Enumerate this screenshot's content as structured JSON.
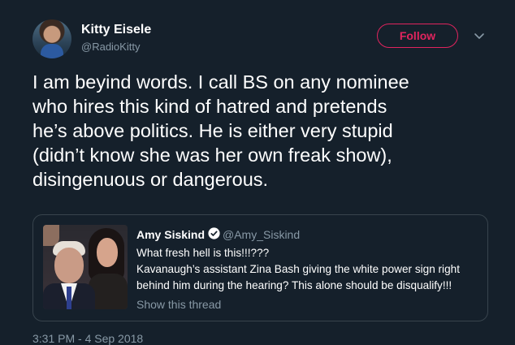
{
  "author": {
    "name": "Kitty Eisele",
    "handle": "@RadioKitty",
    "follow_label": "Follow"
  },
  "tweet": {
    "text": "I am beyind words.  I call BS on any nominee\nwho hires this kind of hatred and pretends\nhe’s above politics.  He is either very stupid\n(didn’t know she was her own freak show),\ndisingenuous or dangerous.",
    "timestamp": "3:31 PM - 4 Sep 2018"
  },
  "quoted": {
    "name": "Amy Siskind",
    "handle": "@Amy_Siskind",
    "text": "What fresh hell is this!!!???\nKavanaugh’s assistant Zina Bash giving the white power sign right\nbehind him during the hearing?  This alone should be disqualify!!!",
    "show_thread": "Show this thread"
  },
  "icons": {
    "avatar": "avatar-photo",
    "chevron": "chevron-down-icon",
    "verified": "verified-badge-icon",
    "quote_image": "hearing-photo"
  },
  "colors": {
    "background": "#15202b",
    "follow_accent": "#e0245e",
    "secondary_text": "#8899a6",
    "border": "#38444d"
  }
}
